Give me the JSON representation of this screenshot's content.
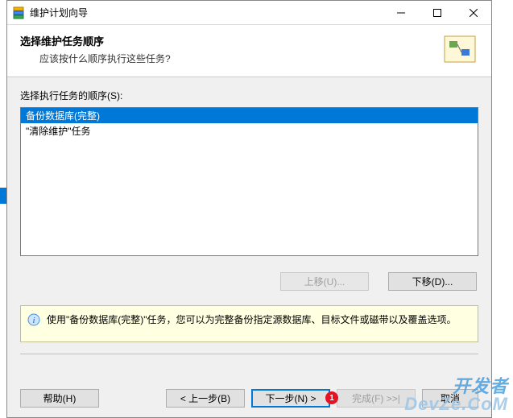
{
  "titlebar": {
    "title": "维护计划向导"
  },
  "header": {
    "title": "选择维护任务顺序",
    "subtitle": "应该按什么顺序执行这些任务?"
  },
  "content": {
    "list_label": "选择执行任务的顺序(S):",
    "items": [
      {
        "label": "备份数据库(完整)",
        "selected": true
      },
      {
        "label": "\"清除维护\"任务",
        "selected": false
      }
    ],
    "move_up": "上移(U)...",
    "move_down": "下移(D)..."
  },
  "info": {
    "text": "使用\"备份数据库(完整)\"任务，您可以为完整备份指定源数据库、目标文件或磁带以及覆盖选项。"
  },
  "footer": {
    "help": "帮助(H)",
    "back": "< 上一步(B)",
    "next": "下一步(N) >",
    "finish": "完成(F) >>|",
    "cancel": "取消",
    "badge": "1"
  },
  "watermark": {
    "line1": "开发者",
    "line2": "DevZe.CoM"
  }
}
